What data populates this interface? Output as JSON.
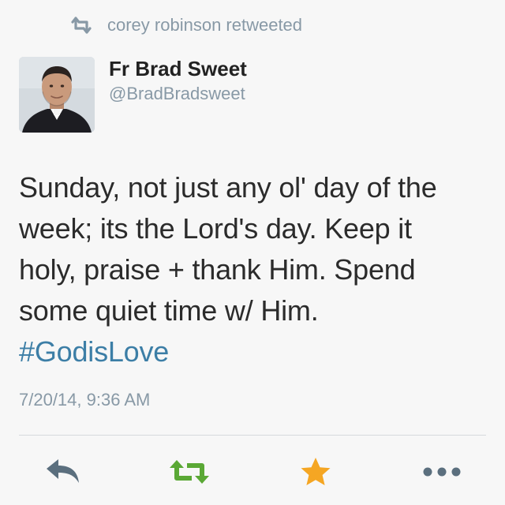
{
  "retweet_banner": {
    "icon": "retweet-icon",
    "text": "corey robinson retweeted"
  },
  "author": {
    "avatar": "avatar-photo",
    "name": "Fr Brad Sweet",
    "handle": "@BradBradsweet"
  },
  "tweet": {
    "lines": [
      "Sunday, not just any ol' day of the",
      "week; its the Lord's day. Keep it",
      "holy, praise + thank Him. Spend",
      "some quiet time w/ Him."
    ],
    "hashtag": "#GodisLove",
    "timestamp": "7/20/14, 9:36 AM"
  },
  "actions": [
    {
      "icon": "reply-icon"
    },
    {
      "icon": "retweet-icon"
    },
    {
      "icon": "favorite-star-icon"
    },
    {
      "icon": "more-dots-icon"
    }
  ],
  "colors": {
    "muted": "#8899a6",
    "hashtag": "#3c7ea6",
    "reply": "#5b6f7e",
    "retweet_active": "#5aa835",
    "favorite_active": "#f5a623",
    "more": "#5b6f7e",
    "background": "#f7f7f7"
  }
}
